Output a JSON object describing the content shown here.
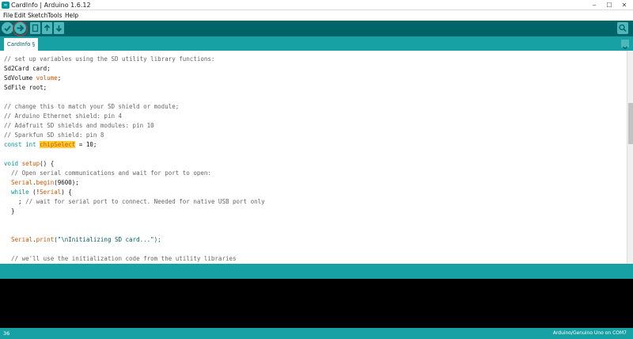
{
  "window": {
    "title": "CardInfo | Arduino 1.6.12",
    "app_icon": "arduino-icon",
    "controls": [
      "minimize-icon",
      "maximize-icon",
      "close-icon"
    ]
  },
  "menu": {
    "items": [
      "File",
      "Edit",
      "Sketch",
      "Tools",
      "Help"
    ]
  },
  "toolbar": {
    "buttons": [
      "verify-icon",
      "upload-icon",
      "new-icon",
      "open-icon",
      "save-icon"
    ],
    "right_button": "serial-monitor-icon"
  },
  "tabs": {
    "active": "CardInfo §"
  },
  "editor": {
    "lines": {
      "l1": "// set up variables using the SD utility library functions:",
      "l2a": "Sd2Card card;",
      "l3a": "SdVolume ",
      "l3b": "volume",
      "l3c": ";",
      "l4a": "SdFile root;",
      "l6": "// change this to match your SD shield or module;",
      "l7": "// Arduino Ethernet shield: pin 4",
      "l8": "// Adafruit SD shields and modules: pin 10",
      "l9": "// Sparkfun SD shield: pin 8",
      "l10a": "const int ",
      "l10b": "chipSelect",
      "l10c": " = 10;",
      "l12a": "void ",
      "l12b": "setup",
      "l12c": "() {",
      "l13": "  // Open serial communications and wait for port to open:",
      "l14a": "  ",
      "l14b": "Serial",
      "l14c": ".",
      "l14d": "begin",
      "l14e": "(9600);",
      "l15a": "  ",
      "l15b": "while",
      "l15c": " (!",
      "l15d": "Serial",
      "l15e": ") {",
      "l16a": "    ; ",
      "l16b": "// wait for serial port to connect. Needed for native USB port only",
      "l17": "  }",
      "l20a": "  ",
      "l20b": "Serial",
      "l20c": ".",
      "l20d": "print",
      "l20e": "(\"\\nInitializing SD card...\");",
      "l22": "  // we'll use the initialization code from the utility libraries"
    }
  },
  "status": {
    "line": "36",
    "board": "Arduino/Genuino Uno on COM7"
  },
  "colors": {
    "toolbar_bg": "#006468",
    "accent": "#17a1a5",
    "highlight": "#ffcc33"
  }
}
